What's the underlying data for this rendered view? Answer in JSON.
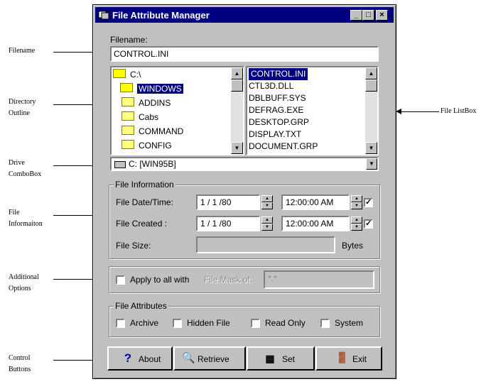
{
  "callouts": {
    "filename": "Filename",
    "directory_outline": [
      "Directory",
      "Outline"
    ],
    "drive_combobox": [
      "Drive",
      "ComboBox"
    ],
    "file_information": [
      "File",
      "Informaiton"
    ],
    "additional_options": [
      "Additional",
      "Options"
    ],
    "control_buttons": [
      "Control",
      "Buttons"
    ],
    "file_listbox": "File ListBox"
  },
  "window": {
    "title": "File Attribute Manager",
    "minimize_glyph": "_",
    "maximize_glyph": "□",
    "close_glyph": "×"
  },
  "filename": {
    "label": "Filename:",
    "value": "CONTROL.INI"
  },
  "directory": {
    "items": [
      {
        "label": "C:\\",
        "open": true,
        "selected": false
      },
      {
        "label": "WINDOWS",
        "open": true,
        "selected": true
      },
      {
        "label": "ADDINS",
        "open": false,
        "selected": false
      },
      {
        "label": "Cabs",
        "open": false,
        "selected": false
      },
      {
        "label": "COMMAND",
        "open": false,
        "selected": false
      },
      {
        "label": "CONFIG",
        "open": false,
        "selected": false
      }
    ]
  },
  "files": {
    "items": [
      {
        "label": "CONTROL.INI",
        "selected": true
      },
      {
        "label": "CTL3D.DLL",
        "selected": false
      },
      {
        "label": "DBLBUFF.SYS",
        "selected": false
      },
      {
        "label": "DEFRAG.EXE",
        "selected": false
      },
      {
        "label": "DESKTOP.GRP",
        "selected": false
      },
      {
        "label": "DISPLAY.TXT",
        "selected": false
      },
      {
        "label": "DOCUMENT.GRP",
        "selected": false
      }
    ]
  },
  "drive": {
    "value": "C: [WIN95B]"
  },
  "file_info": {
    "title": "File Information",
    "date_time_label": "File Date/Time:",
    "date_value": "1 / 1 /80",
    "time_value": "12:00:00 AM",
    "date_time_checked": true,
    "created_label": "File Created :",
    "created_date_value": "1 / 1 /80",
    "created_time_value": "12:00:00 AM",
    "created_checked": true,
    "size_label": "File Size:",
    "size_value": "",
    "size_unit": "Bytes"
  },
  "options": {
    "apply_label": "Apply to all with",
    "apply_checked": false,
    "mask_label": "File Mask of:",
    "mask_value": "*.*"
  },
  "attributes": {
    "title": "File Attributes",
    "items": [
      {
        "label": "Archive",
        "checked": false
      },
      {
        "label": "Hidden File",
        "checked": false
      },
      {
        "label": "Read Only",
        "checked": false
      },
      {
        "label": "System",
        "checked": false
      }
    ]
  },
  "buttons": {
    "about": "About",
    "retrieve": "Retrieve",
    "set": "Set",
    "exit": "Exit"
  }
}
